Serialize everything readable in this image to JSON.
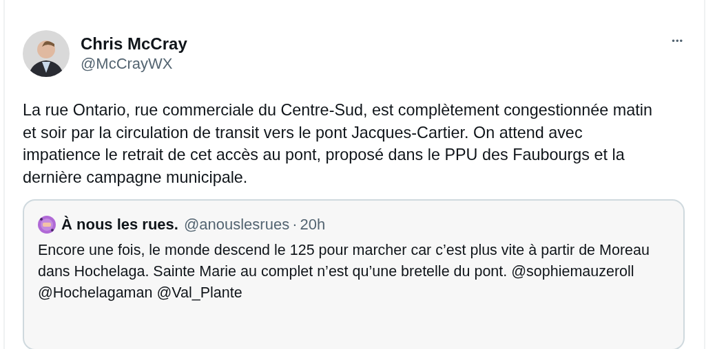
{
  "author": {
    "name": "Chris McCray",
    "handle": "@McCrayWX"
  },
  "more_menu": "•••",
  "text": "La rue Ontario, rue commerciale du Centre-Sud, est complètement congestionnée matin et soir par la circulation de transit vers le pont Jacques-Cartier. On attend avec impatience le retrait de cet accès au pont, proposé dans le PPU des Faubourgs et la dernière campagne municipale.",
  "quoted_post": {
    "author": {
      "name": "À nous les rues.",
      "handle": "@anouslesrues"
    },
    "separator": "·",
    "time": "20h",
    "text": "Encore une fois, le monde descend le 125 pour marcher car c’est plus vite à partir de Moreau dans Hochelaga. Sainte Marie au complet n’est qu’une bretelle du pont. @sophiemauzeroll @Hochelagaman @Val_Plante"
  }
}
